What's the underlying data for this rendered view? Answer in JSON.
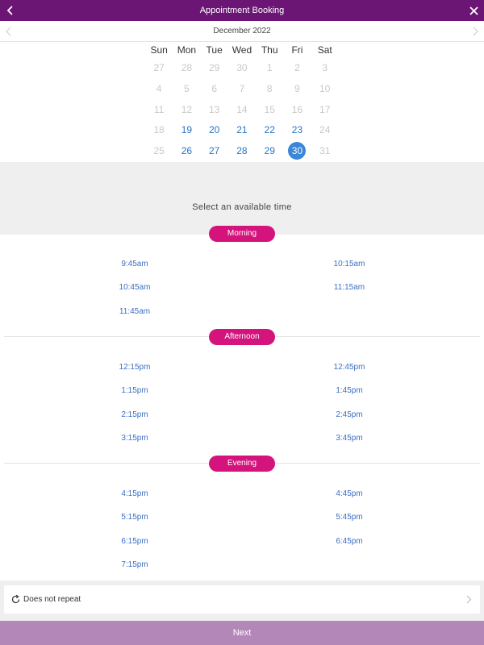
{
  "header": {
    "title": "Appointment Booking"
  },
  "calendar": {
    "month_label": "December 2022",
    "weekdays": [
      "Sun",
      "Mon",
      "Tue",
      "Wed",
      "Thu",
      "Fri",
      "Sat"
    ],
    "weeks": [
      [
        {
          "d": "27",
          "s": "muted"
        },
        {
          "d": "28",
          "s": "muted"
        },
        {
          "d": "29",
          "s": "muted"
        },
        {
          "d": "30",
          "s": "muted"
        },
        {
          "d": "1",
          "s": "muted"
        },
        {
          "d": "2",
          "s": "muted"
        },
        {
          "d": "3",
          "s": "muted"
        }
      ],
      [
        {
          "d": "4",
          "s": "muted"
        },
        {
          "d": "5",
          "s": "muted"
        },
        {
          "d": "6",
          "s": "muted"
        },
        {
          "d": "7",
          "s": "muted"
        },
        {
          "d": "8",
          "s": "muted"
        },
        {
          "d": "9",
          "s": "muted"
        },
        {
          "d": "10",
          "s": "muted"
        }
      ],
      [
        {
          "d": "11",
          "s": "muted"
        },
        {
          "d": "12",
          "s": "muted"
        },
        {
          "d": "13",
          "s": "muted"
        },
        {
          "d": "14",
          "s": "muted"
        },
        {
          "d": "15",
          "s": "muted"
        },
        {
          "d": "16",
          "s": "muted"
        },
        {
          "d": "17",
          "s": "muted"
        }
      ],
      [
        {
          "d": "18",
          "s": "muted"
        },
        {
          "d": "19",
          "s": "avail"
        },
        {
          "d": "20",
          "s": "avail"
        },
        {
          "d": "21",
          "s": "avail"
        },
        {
          "d": "22",
          "s": "avail"
        },
        {
          "d": "23",
          "s": "avail"
        },
        {
          "d": "24",
          "s": "muted"
        }
      ],
      [
        {
          "d": "25",
          "s": "muted"
        },
        {
          "d": "26",
          "s": "avail"
        },
        {
          "d": "27",
          "s": "avail"
        },
        {
          "d": "28",
          "s": "avail"
        },
        {
          "d": "29",
          "s": "avail"
        },
        {
          "d": "30",
          "s": "selected"
        },
        {
          "d": "31",
          "s": "muted"
        }
      ]
    ]
  },
  "prompt": "Select an available time",
  "sections": [
    {
      "name": "Morning",
      "left": [
        "9:45am",
        "10:45am",
        "11:45am"
      ],
      "right": [
        "10:15am",
        "11:15am"
      ]
    },
    {
      "name": "Afternoon",
      "left": [
        "12:15pm",
        "1:15pm",
        "2:15pm",
        "3:15pm"
      ],
      "right": [
        "12:45pm",
        "1:45pm",
        "2:45pm",
        "3:45pm"
      ]
    },
    {
      "name": "Evening",
      "left": [
        "4:15pm",
        "5:15pm",
        "6:15pm",
        "7:15pm"
      ],
      "right": [
        "4:45pm",
        "5:45pm",
        "6:45pm"
      ]
    }
  ],
  "repeat": {
    "label": "Does not repeat",
    "icon": "repeat-icon"
  },
  "footer": {
    "next_label": "Next"
  },
  "colors": {
    "header": "#6b1674",
    "pill": "#d4147c",
    "link": "#3b6fc4",
    "selected": "#3a86d8",
    "next": "#b487b9"
  }
}
